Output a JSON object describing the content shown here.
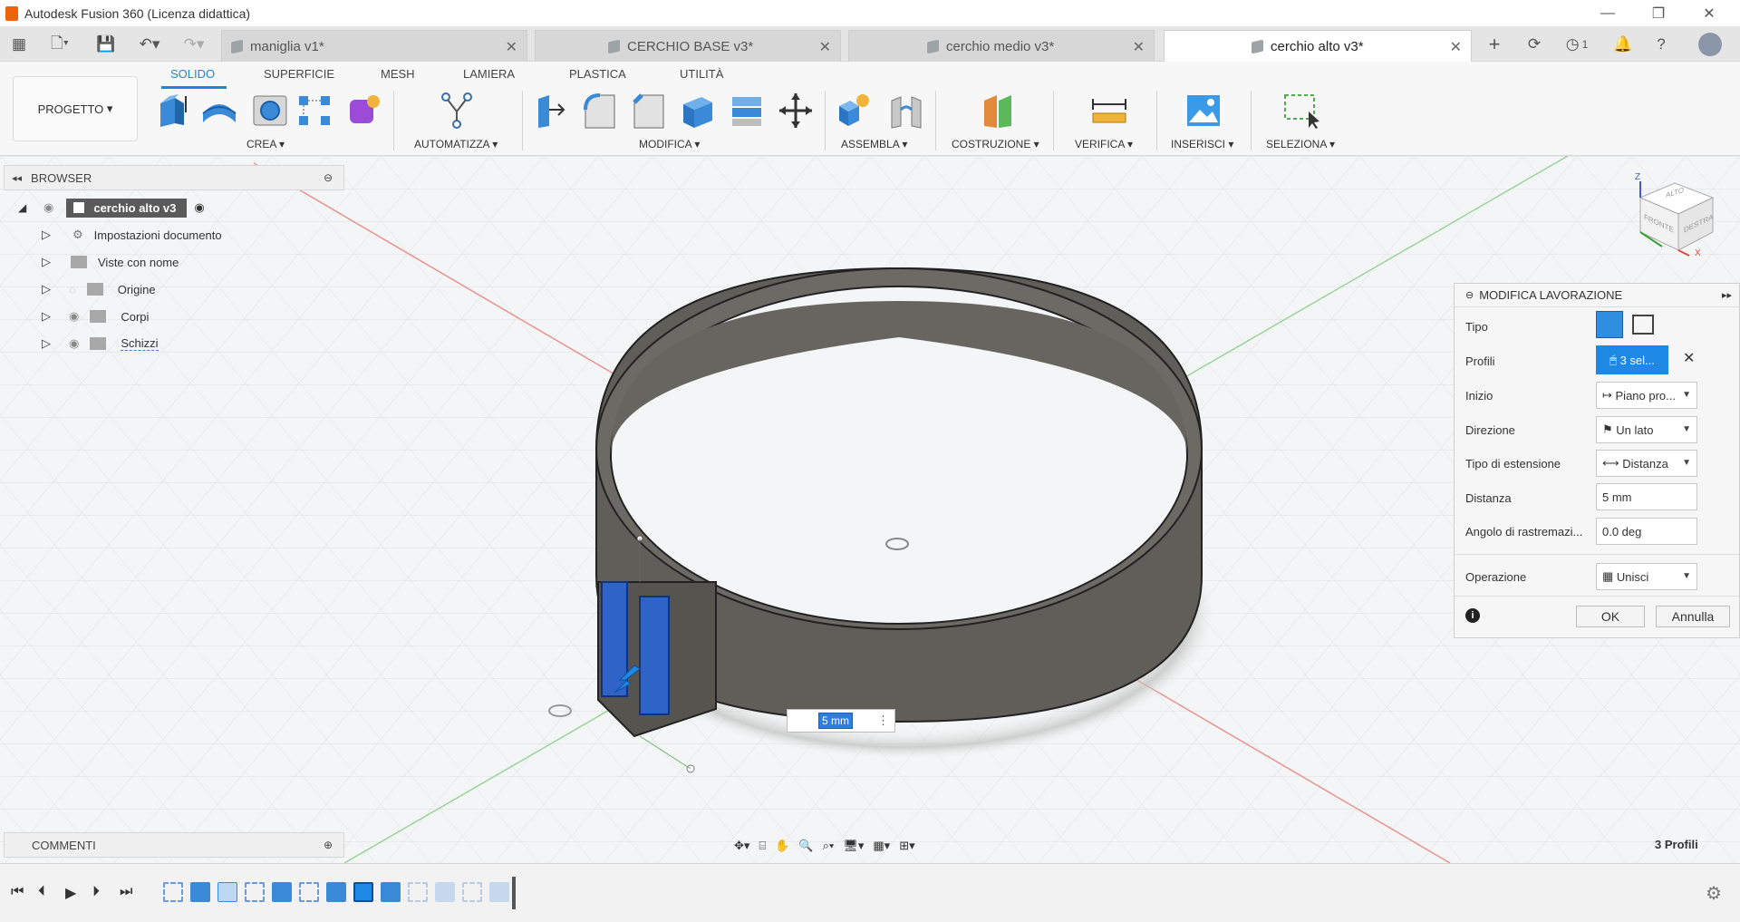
{
  "window": {
    "title": "Autodesk Fusion 360 (Licenza didattica)"
  },
  "tabs": [
    {
      "label": "maniglia v1*"
    },
    {
      "label": "CERCHIO BASE v3*"
    },
    {
      "label": "cerchio medio v3*"
    },
    {
      "label": "cerchio alto v3*"
    }
  ],
  "tab_extra": {
    "notif_count": "1"
  },
  "ribbon": {
    "workspace": "PROGETTO",
    "tabs": [
      "SOLIDO",
      "SUPERFICIE",
      "MESH",
      "LAMIERA",
      "PLASTICA",
      "UTILITÀ"
    ],
    "groups": [
      "CREA",
      "AUTOMATIZZA",
      "MODIFICA",
      "ASSEMBLA",
      "COSTRUZIONE",
      "VERIFICA",
      "INSERISCI",
      "SELEZIONA"
    ]
  },
  "browser": {
    "title": "BROWSER",
    "root": "cerchio alto v3",
    "items": [
      "Impostazioni documento",
      "Viste con nome",
      "Origine",
      "Corpi",
      "Schizzi"
    ]
  },
  "comments": {
    "title": "COMMENTI"
  },
  "panel": {
    "title": "MODIFICA LAVORAZIONE",
    "rows": {
      "tipo": "Tipo",
      "profili": "Profili",
      "profili_value": "3 sel...",
      "inizio": "Inizio",
      "inizio_value": "Piano pro...",
      "direzione": "Direzione",
      "direzione_value": "Un lato",
      "tipo_est": "Tipo di estensione",
      "tipo_est_value": "Distanza",
      "distanza": "Distanza",
      "distanza_value": "5 mm",
      "angolo": "Angolo di rastremazi...",
      "angolo_value": "0.0 deg",
      "operazione": "Operazione",
      "operazione_value": "Unisci"
    },
    "ok": "OK",
    "cancel": "Annulla"
  },
  "viewport": {
    "dim_value": "5 mm",
    "cube_top": "ALTO",
    "cube_front": "FRONTE",
    "cube_right": "DESTRA"
  },
  "status": {
    "profiles": "3 Profili"
  },
  "colors": {
    "accent": "#1b86d6",
    "body": "#5f5e58",
    "selection": "#2f7de0"
  }
}
